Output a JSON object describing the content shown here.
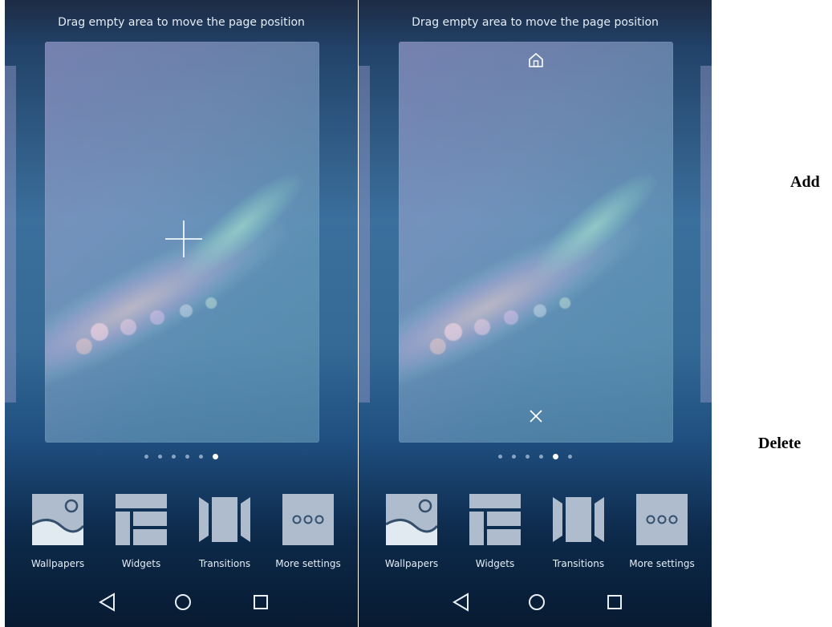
{
  "screens": [
    {
      "hint": "Drag empty area to move the page position",
      "page_count": 6,
      "active_page_index": 5,
      "tools": [
        {
          "label": "Wallpapers",
          "icon": "wallpaper-icon"
        },
        {
          "label": "Widgets",
          "icon": "widgets-icon"
        },
        {
          "label": "Transitions",
          "icon": "transitions-icon"
        },
        {
          "label": "More settings",
          "icon": "more-settings-icon"
        }
      ],
      "nav": [
        "back-icon",
        "home-circle-icon",
        "recents-icon"
      ]
    },
    {
      "hint": "Drag empty area to move the page position",
      "page_count": 6,
      "active_page_index": 4,
      "tools": [
        {
          "label": "Wallpapers",
          "icon": "wallpaper-icon"
        },
        {
          "label": "Widgets",
          "icon": "widgets-icon"
        },
        {
          "label": "Transitions",
          "icon": "transitions-icon"
        },
        {
          "label": "More settings",
          "icon": "more-settings-icon"
        }
      ],
      "nav": [
        "back-icon",
        "home-circle-icon",
        "recents-icon"
      ]
    }
  ],
  "captions": {
    "add": "Add",
    "delete": "Delete"
  },
  "colors": {
    "icon_tile": "#aebccd",
    "active_dot": "#ffffff"
  }
}
